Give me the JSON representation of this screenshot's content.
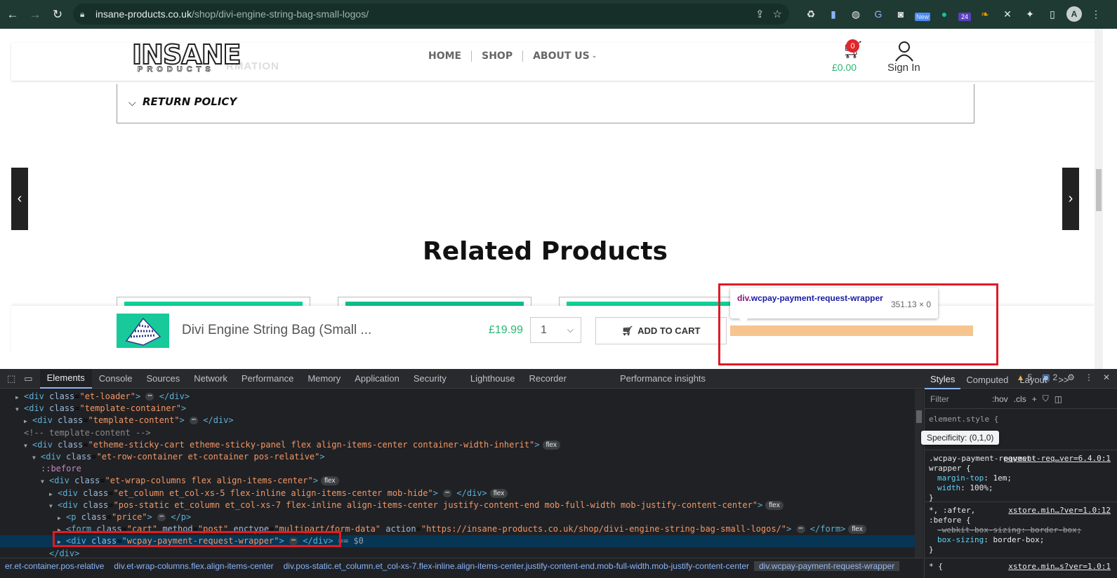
{
  "browser": {
    "url_host": "insane-products.co.uk",
    "url_path": "/shop/divi-engine-string-bag-small-logos/",
    "extensions": [
      "recycle",
      "docs",
      "globe",
      "translate",
      "camera",
      "New",
      "grammarly",
      "24",
      "leaf",
      "x",
      "puzzle",
      "sidebar"
    ],
    "avatar_letter": "A"
  },
  "site": {
    "logo": "INSANE",
    "logo_sub": "PRODUCTS",
    "ghost_text": "RMATION",
    "nav": [
      "HOME",
      "SHOP",
      "ABOUT US"
    ],
    "cart_count": "0",
    "cart_total": "£0.00",
    "sign_in": "Sign In"
  },
  "page": {
    "return_policy": "RETURN POLICY",
    "related_heading": "Related Products"
  },
  "sticky_cart": {
    "product_name": "Divi Engine String Bag (Small ...",
    "price": "£19.99",
    "quantity": "1",
    "add_to_cart": "ADD TO CART"
  },
  "inspect_tooltip": {
    "tag": "div",
    "class": ".wcpay-payment-request-wrapper",
    "size": "351.13 × 0"
  },
  "devtools": {
    "tabs": [
      "Elements",
      "Console",
      "Sources",
      "Network",
      "Performance",
      "Memory",
      "Application",
      "Security",
      "Lighthouse",
      "Recorder",
      "Performance insights"
    ],
    "warnings": "5",
    "messages": "2",
    "dom_lines": [
      {
        "indent": 2,
        "tri": "▶",
        "html": "<div class=\"et-loader\">",
        "dots": true,
        "close": "</div>"
      },
      {
        "indent": 2,
        "tri": "▼",
        "html": "<div class=\"template-container\">"
      },
      {
        "indent": 3,
        "tri": "▶",
        "html": "<div class=\"template-content\">",
        "dots": true,
        "close": "</div>"
      },
      {
        "indent": 3,
        "comment": "<!-- template-content -->"
      },
      {
        "indent": 3,
        "tri": "▼",
        "html": "<div class=\"etheme-sticky-cart etheme-sticky-panel flex align-items-center container-width-inherit\">",
        "flex": true
      },
      {
        "indent": 4,
        "tri": "▼",
        "html": "<div class=\"et-row-container et-container pos-relative\">"
      },
      {
        "indent": 5,
        "pseudo": "::before"
      },
      {
        "indent": 5,
        "tri": "▼",
        "html": "<div class=\"et-wrap-columns flex align-items-center\">",
        "flex": true
      },
      {
        "indent": 6,
        "tri": "▶",
        "html": "<div class=\"et_column et_col-xs-5 flex-inline align-items-center mob-hide\">",
        "dots": true,
        "close": "</div>",
        "flex": true
      },
      {
        "indent": 6,
        "tri": "▼",
        "html": "<div class=\"pos-static et_column et_col-xs-7 flex-inline align-items-center justify-content-end mob-full-width mob-justify-content-center\">",
        "flex": true
      },
      {
        "indent": 7,
        "tri": "▶",
        "html": "<p class=\"price\">",
        "dots": true,
        "close": "</p>"
      },
      {
        "indent": 7,
        "tri": "▶",
        "html": "<form class=\"cart\" method=\"post\" enctype=\"multipart/form-data\" action=\"https://insane-products.co.uk/shop/divi-engine-string-bag-small-logos/\">",
        "dots": true,
        "close": "</form>",
        "flex": true
      },
      {
        "indent": 7,
        "tri": "▶",
        "html": "<div class=\"wcpay-payment-request-wrapper\">",
        "dots": true,
        "close": "</div>",
        "eq": " == $0",
        "selected": true
      },
      {
        "indent": 6,
        "html": "</div>"
      }
    ],
    "breadcrumbs": [
      "er.et-container.pos-relative",
      "div.et-wrap-columns.flex.align-items-center",
      "div.pos-static.et_column.et_col-xs-7.flex-inline.align-items-center.justify-content-end.mob-full-width.mob-justify-content-center",
      "div.wcpay-payment-request-wrapper"
    ],
    "styles": {
      "tabs": [
        "Styles",
        "Computed",
        "Layout",
        ">>"
      ],
      "filter_placeholder": "Filter",
      "hov": ":hov",
      "cls": ".cls",
      "specificity": "Specificity: (0,1,0)",
      "rule1_selector": ".wcpay-payment-request-wrapper {",
      "rule1_source": "payment-req…ver=6.4.0:1",
      "rule1_props": [
        [
          "margin-top",
          "1em;"
        ],
        [
          "width",
          "100%;"
        ]
      ],
      "rule2_selector": "*, :after, :before {",
      "rule2_source": "xstore.min…?ver=1.0:12",
      "rule2_props": [
        [
          "-webkit-box-sizing",
          "border-box;"
        ],
        [
          "box-sizing",
          "border-box;"
        ]
      ],
      "rule3_selector": "* {",
      "rule3_source": "xstore.min…s?ver=1.0:1"
    }
  }
}
